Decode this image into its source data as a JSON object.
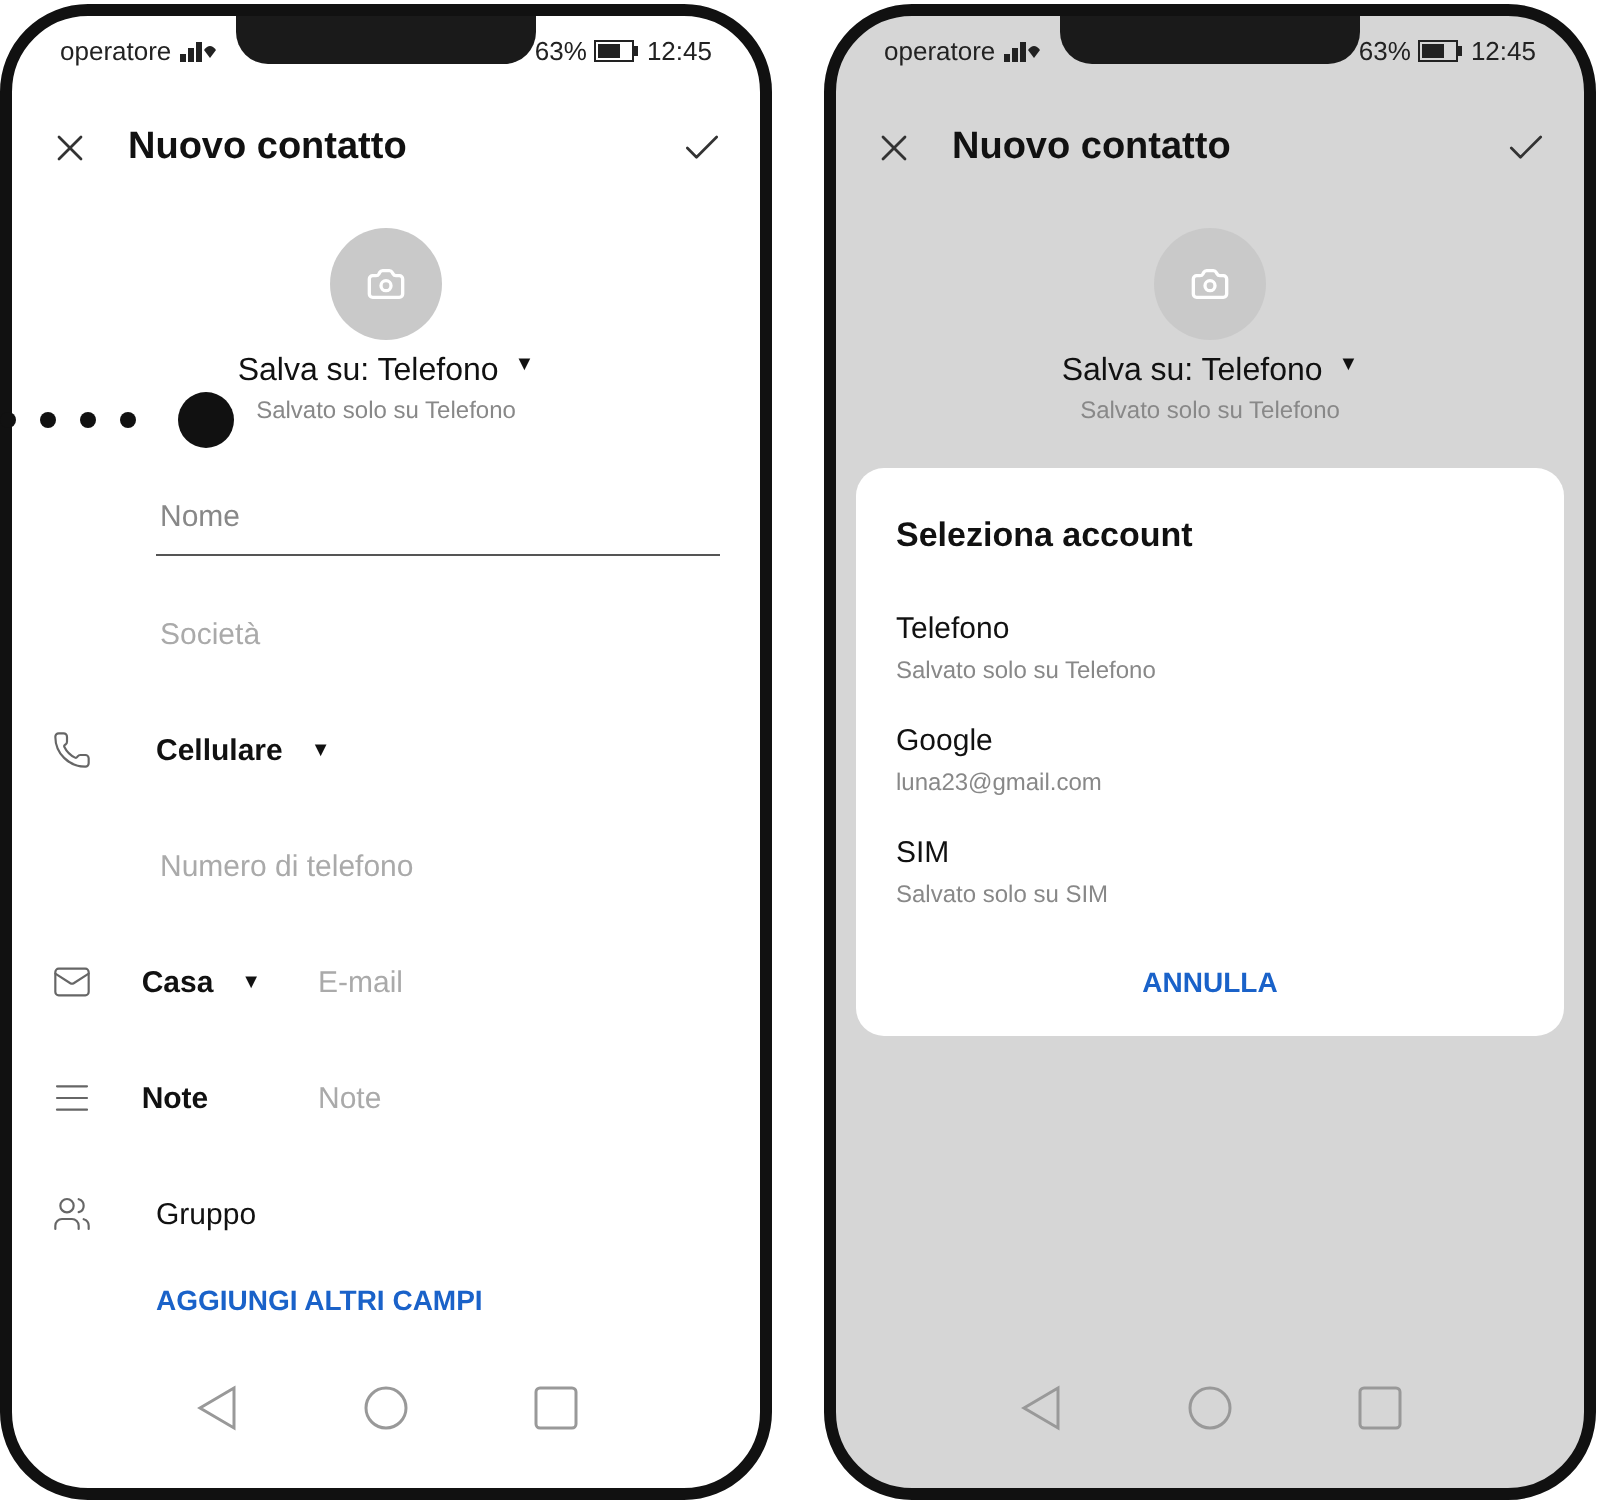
{
  "phones": [
    {
      "dimmed": false,
      "status": {
        "carrier": "operatore",
        "battery": "63%",
        "time": "12:45"
      },
      "header": {
        "title": "Nuovo contatto"
      },
      "save_to": {
        "label": "Salva su: Telefono",
        "caret": "▼",
        "note": "Salvato solo su Telefono"
      },
      "rows": [
        {
          "kind": "text-field",
          "placeholder": "Nome",
          "focused": true
        },
        {
          "kind": "text-field",
          "placeholder": "Società",
          "focused": false
        },
        {
          "kind": "phone",
          "label": "Cellulare",
          "caret": "▼"
        },
        {
          "kind": "text-field",
          "placeholder": "Numero di telefono",
          "focused": false
        },
        {
          "kind": "email",
          "label": "Casa",
          "caret": "▼",
          "placeholder": "E-mail"
        },
        {
          "kind": "note",
          "label": "Note",
          "placeholder": "Note"
        },
        {
          "kind": "group",
          "label": "Gruppo"
        }
      ],
      "more_fields": "AGGIUNGI ALTRI CAMPI"
    },
    {
      "dimmed": true,
      "status": {
        "carrier": "operatore",
        "battery": "63%",
        "time": "12:45"
      },
      "header": {
        "title": "Nuovo contatto"
      },
      "save_to": {
        "label": "Salva su: Telefono",
        "caret": "▼",
        "note": "Salvato solo su Telefono"
      },
      "dialog": {
        "title": "Seleziona account",
        "accounts": [
          {
            "name": "Telefono",
            "detail": "Salvato solo su Telefono"
          },
          {
            "name": "Google",
            "detail": "luna23@gmail.com"
          },
          {
            "name": "SIM",
            "detail": "Salvato solo su SIM"
          }
        ],
        "cancel": "ANNULLA"
      }
    }
  ]
}
